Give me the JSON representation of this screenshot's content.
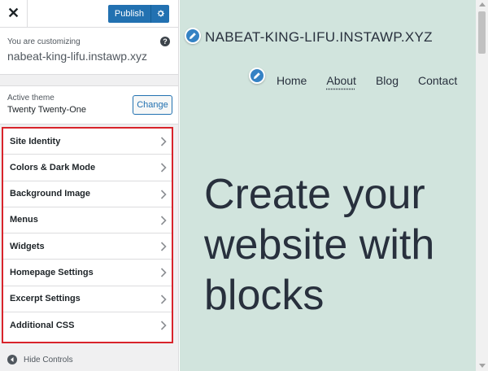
{
  "topbar": {
    "close_icon": "close-icon",
    "publish_label": "Publish",
    "gear_icon": "gear-icon"
  },
  "customizing": {
    "label": "You are customizing",
    "site": "nabeat-king-lifu.instawp.xyz",
    "help_icon": "help-icon"
  },
  "theme": {
    "label": "Active theme",
    "name": "Twenty Twenty-One",
    "change_label": "Change"
  },
  "sections": [
    {
      "label": "Site Identity"
    },
    {
      "label": "Colors & Dark Mode"
    },
    {
      "label": "Background Image"
    },
    {
      "label": "Menus"
    },
    {
      "label": "Widgets"
    },
    {
      "label": "Homepage Settings"
    },
    {
      "label": "Excerpt Settings"
    },
    {
      "label": "Additional CSS"
    }
  ],
  "hide_controls": "Hide Controls",
  "preview": {
    "site_title": "NABEAT-KING-LIFU.INSTAWP.XYZ",
    "nav": [
      "Home",
      "About",
      "Blog",
      "Contact"
    ],
    "current_nav": "About",
    "hero": "Create your website with blocks"
  },
  "colors": {
    "accent": "#2271b1",
    "preview_bg": "#d1e4dd",
    "highlight_border": "#d8242b"
  }
}
